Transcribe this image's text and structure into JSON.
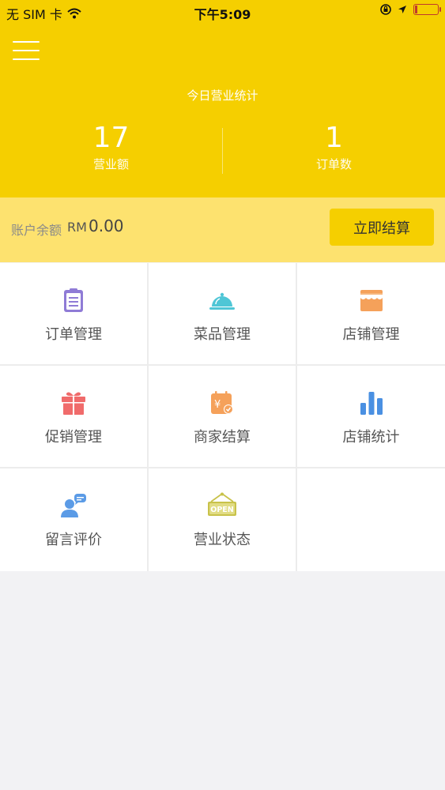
{
  "status_bar": {
    "carrier": "无 SIM 卡",
    "time": "下午5:09"
  },
  "header": {
    "title": "今日营业统计",
    "revenue": {
      "value": "17",
      "label": "营业额"
    },
    "orders": {
      "value": "1",
      "label": "订单数"
    }
  },
  "balance": {
    "label": "账户余额",
    "currency": "RM",
    "amount": "0.00",
    "button_label": "立即结算"
  },
  "menu": [
    {
      "label": "订单管理",
      "icon": "clipboard-icon",
      "color": "#8f7bd6"
    },
    {
      "label": "菜品管理",
      "icon": "dish-cover-icon",
      "color": "#4fc6d6"
    },
    {
      "label": "店铺管理",
      "icon": "store-icon",
      "color": "#f5a15a"
    },
    {
      "label": "促销管理",
      "icon": "gift-icon",
      "color": "#f06b6b"
    },
    {
      "label": "商家结算",
      "icon": "calendar-check-icon",
      "color": "#f5a15a"
    },
    {
      "label": "店铺统计",
      "icon": "bar-chart-icon",
      "color": "#4a90e2"
    },
    {
      "label": "留言评价",
      "icon": "user-chat-icon",
      "color": "#5b9be6"
    },
    {
      "label": "营业状态",
      "icon": "open-sign-icon",
      "color": "#c8c24a",
      "sign_text": "OPEN"
    }
  ]
}
